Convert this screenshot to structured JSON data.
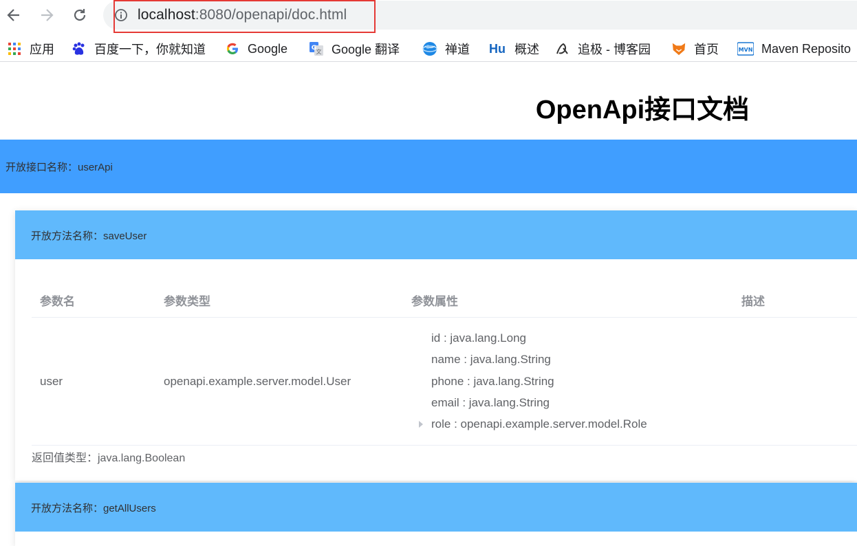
{
  "browser": {
    "url_host": "localhost",
    "url_rest": ":8080/openapi/doc.html",
    "bookmarks": [
      {
        "label": "应用",
        "icon": "apps-grid-icon"
      },
      {
        "label": "百度一下，你就知道",
        "icon": "baidu-paw-icon"
      },
      {
        "label": "Google",
        "icon": "google-g-icon"
      },
      {
        "label": "Google 翻译",
        "icon": "google-translate-icon"
      },
      {
        "label": "禅道",
        "icon": "zentao-globe-icon"
      },
      {
        "label": "概述",
        "icon": "hu-logo-icon",
        "icon_text": "Hu"
      },
      {
        "label": "追极 - 博客园",
        "icon": "cnblogs-icon"
      },
      {
        "label": "首页",
        "icon": "fox-logo-icon"
      },
      {
        "label": "Maven Reposito",
        "icon": "mvn-logo-icon",
        "icon_text": "MVN"
      }
    ]
  },
  "page": {
    "title": "OpenApi接口文档",
    "api": {
      "label": "开放接口名称：userApi"
    },
    "methods": [
      {
        "label": "开放方法名称：saveUser",
        "columns": [
          "参数名",
          "参数类型",
          "参数属性",
          "描述"
        ],
        "param_name": "user",
        "param_type": "openapi.example.server.model.User",
        "properties": [
          "id : java.lang.Long",
          "name : java.lang.String",
          "phone : java.lang.String",
          "email : java.lang.String",
          "role : openapi.example.server.model.Role"
        ],
        "description": "",
        "return_label": "返回值类型：java.lang.Boolean"
      },
      {
        "label": "开放方法名称：getAllUsers"
      }
    ]
  },
  "colors": {
    "api_bar": "#409eff",
    "method_bar": "#60b9fc",
    "highlight_border": "#e53935"
  }
}
